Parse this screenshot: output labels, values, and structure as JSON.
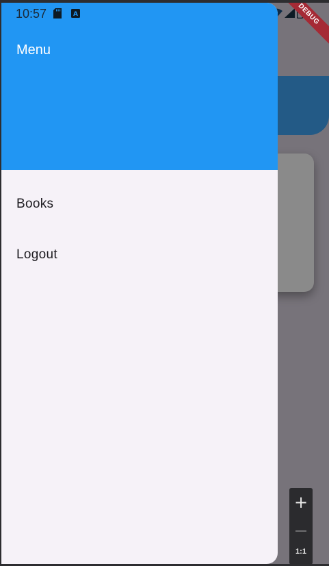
{
  "status_bar": {
    "time": "10:57",
    "left_icons": [
      "sd-card-icon",
      "keyboard-a-icon"
    ],
    "right_icons": [
      "wifi-icon",
      "signal-icon",
      "battery-icon"
    ]
  },
  "drawer": {
    "header_title": "Menu",
    "header_color": "#2196f3",
    "items": [
      {
        "label": "Books"
      },
      {
        "label": "Logout"
      }
    ]
  },
  "debug_banner": {
    "label": "DEBUG",
    "color": "#a52a35"
  },
  "zoom_control": {
    "plus_label": "+",
    "ratio_label": "1:1"
  }
}
